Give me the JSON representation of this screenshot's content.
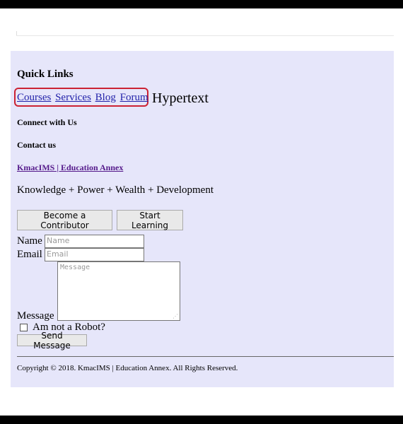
{
  "footer": {
    "quick_links": {
      "title": "Quick Links",
      "links": [
        {
          "label": "Courses"
        },
        {
          "label": "Services"
        },
        {
          "label": "Blog"
        },
        {
          "label": "Forum"
        }
      ],
      "annotation": "Hypertext"
    },
    "connect_title": "Connect with Us",
    "contact_title": "Contact us",
    "brand_link": "KmacIMS | Education Annex",
    "tagline": "Knowledge + Power + Wealth + Development",
    "buttons": {
      "contributor": "Become a Contributor",
      "learning": "Start Learning"
    },
    "form": {
      "name_label": "Name",
      "name_placeholder": "Name",
      "email_label": "Email",
      "email_placeholder": "Email",
      "message_label": "Message",
      "message_placeholder": "Message",
      "robot_label": "Am not a Robot?",
      "robot_checked": false,
      "send_label": "Send Message"
    },
    "copyright": "Copyright © 2018. KmacIMS | Education Annex. All Rights Reserved."
  },
  "colors": {
    "footer_bg": "#e6e6fa",
    "link": "#2222aa",
    "visited_link": "#551a8b",
    "highlight": "#cc2233"
  }
}
